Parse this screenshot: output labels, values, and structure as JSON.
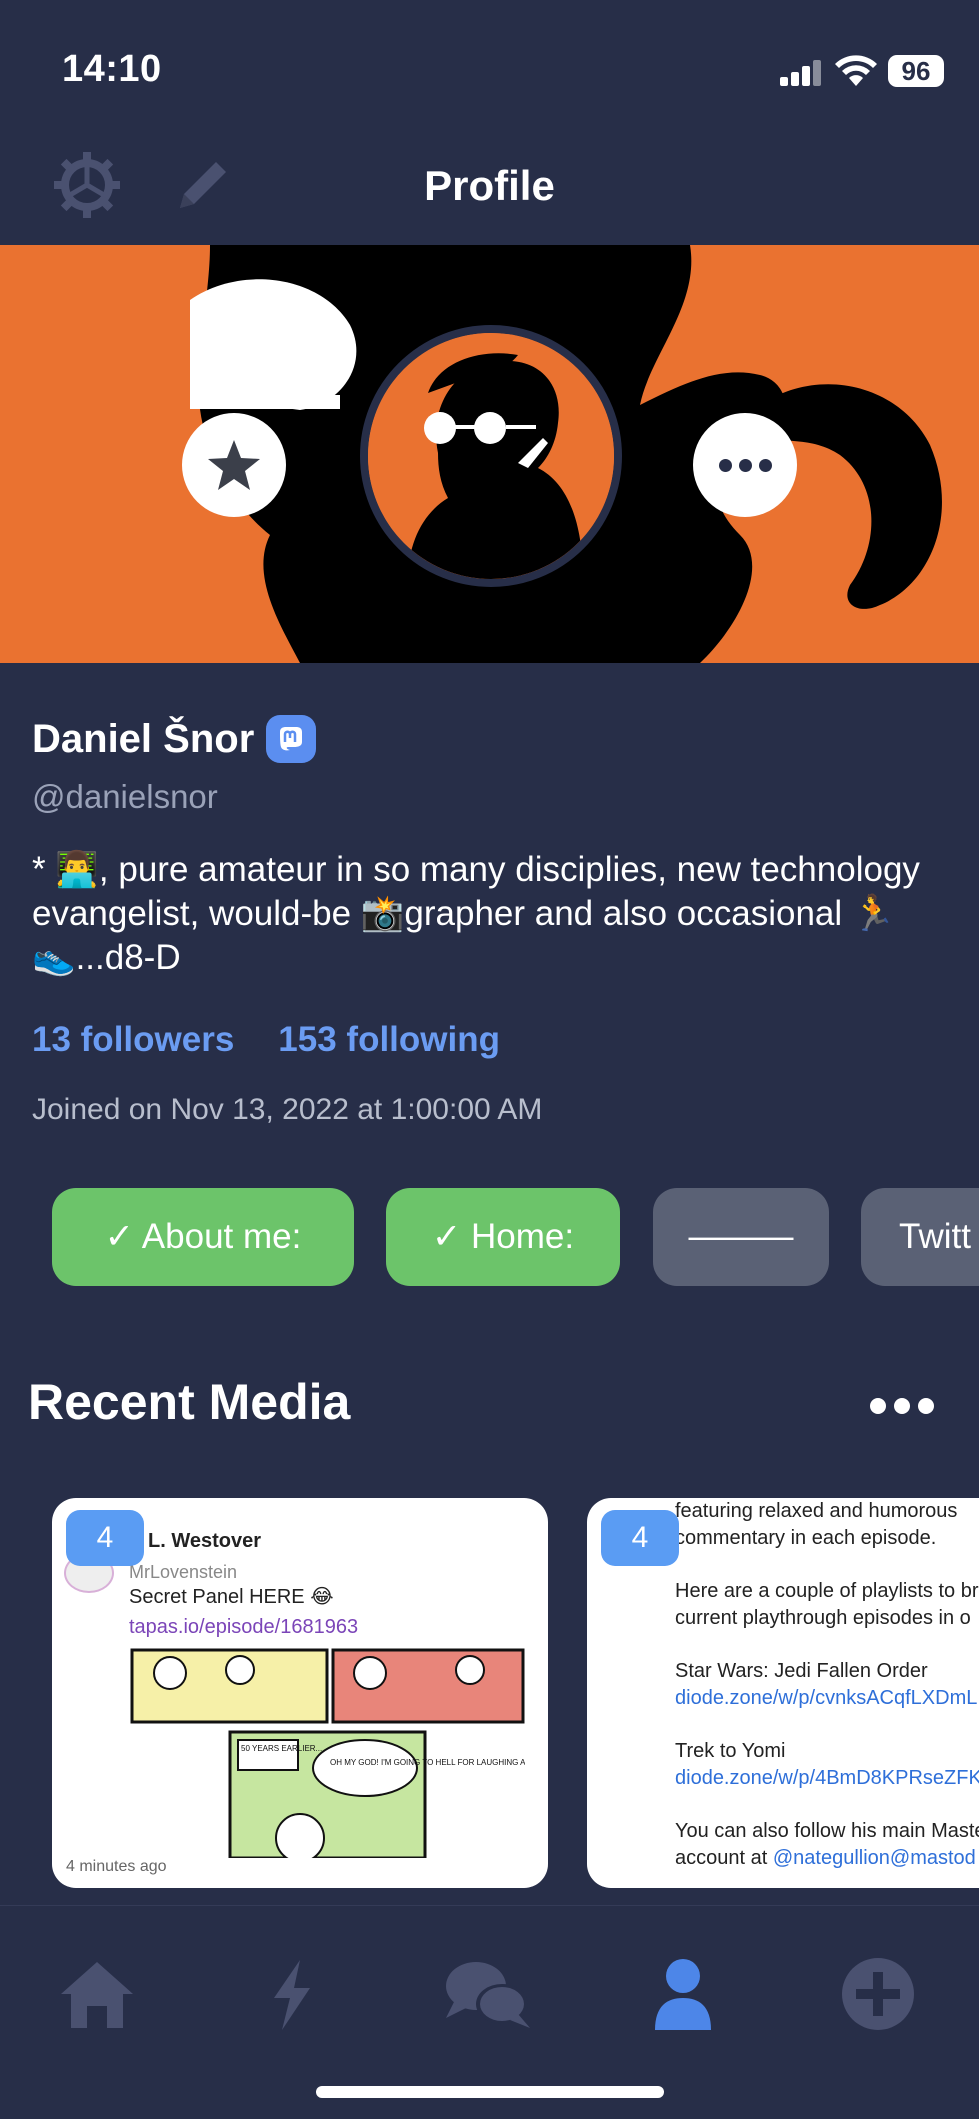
{
  "status_bar": {
    "time": "14:10",
    "battery": "96"
  },
  "nav": {
    "title": "Profile",
    "left_icons": [
      "gear-icon",
      "pencil-icon"
    ]
  },
  "profile": {
    "display_name": "Daniel Šnor",
    "handle": "@danielsnor",
    "bio": "* 👨‍💻, pure amateur in so many disciplies, new technology evangelist, would-be 📸grapher and also occasional 🏃 👟...d8-D",
    "followers": "13 followers",
    "following": "153 following",
    "joined": "Joined on Nov 13, 2022 at 1:00:00 AM"
  },
  "fields": [
    {
      "label": "✓ About me:",
      "verified": true
    },
    {
      "label": "✓ Home:",
      "verified": true
    },
    {
      "label": "———",
      "verified": false
    },
    {
      "label": "Twitt",
      "verified": false
    }
  ],
  "recent_media": {
    "title": "Recent Media",
    "cards": [
      {
        "count": "4",
        "author": "L. Westover",
        "username": "MrLovenstein",
        "text": "Secret Panel HERE 😂",
        "link": "tapas.io/episode/1681963",
        "comic_caption_1": "50 YEARS EARLIER...",
        "comic_caption_2": "OH MY GOD! I'M GOING TO HELL FOR LAUGHING AT THIS!",
        "time": "4 minutes ago"
      },
      {
        "count": "4",
        "line1": "featuring relaxed and humorous",
        "line2": "commentary in each episode.",
        "line3": "Here are a couple of playlists to br",
        "line4": "current playthrough episodes in o",
        "line5": "Star Wars: Jedi Fallen Order",
        "link1": "diode.zone/w/p/cvnksACqfLXDmL",
        "line6": "Trek to Yomi",
        "link2": "diode.zone/w/p/4BmD8KPRseZFK",
        "line7": "You can also follow his main Maste",
        "line8_prefix": "account at ",
        "line8_link": "@nategullion@mastod"
      }
    ]
  },
  "tab_bar": [
    "home-icon",
    "bolt-icon",
    "chat-bubbles-icon",
    "profile-icon",
    "plus-circle-icon"
  ],
  "colors": {
    "background": "#272e48",
    "accent": "#6b9cf2",
    "banner": "#ea7230",
    "verified": "#6cc46a",
    "active_tab": "#4d86e8",
    "inactive_tab": "#4a5170"
  }
}
